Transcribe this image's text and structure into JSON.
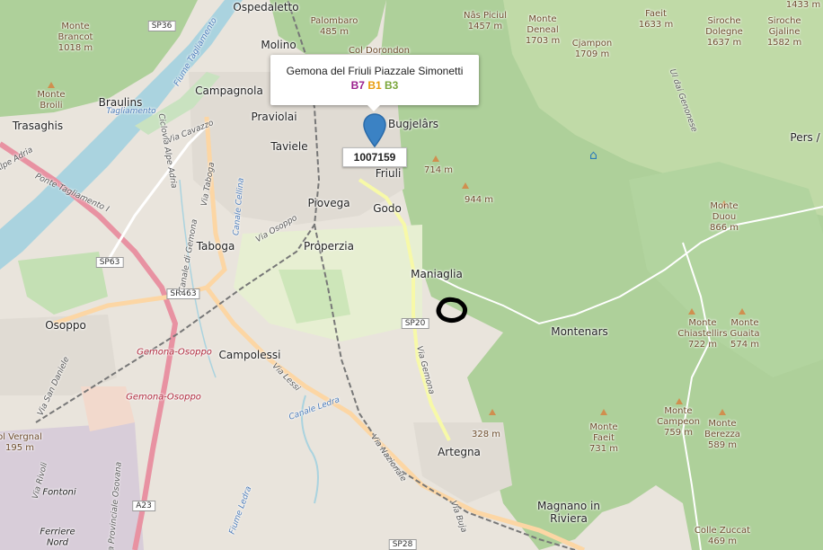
{
  "popup": {
    "title": "Gemona del Friuli Piazzale Simonetti",
    "codes": [
      {
        "text": "B7",
        "color": "#9b1f8e"
      },
      {
        "text": "B1",
        "color": "#e89b0c"
      },
      {
        "text": "B3",
        "color": "#7aa63a"
      }
    ]
  },
  "marker": {
    "label": "1007159",
    "color": "#3b82c4"
  },
  "towns": {
    "ospedaletto": "Ospedaletto",
    "molino": "Molino",
    "campagnola": "Campagnola",
    "praviolai": "Praviolai",
    "taviele": "Taviele",
    "braulins": "Braulins",
    "trasaghis": "Trasaghis",
    "piovega": "Piovega",
    "godo": "Godo",
    "friuli": "Friuli",
    "bugjelars": "Bugjelârs",
    "taboga": "Taboga",
    "properzia": "Properzia",
    "maniaglia": "Maniaglia",
    "osoppo": "Osoppo",
    "campolessi": "Campolessi",
    "montenars": "Montenars",
    "artegna": "Artegna",
    "magnano_1": "Magnano in",
    "magnano_2": "Riviera",
    "fontoni": "Fontoni",
    "ferriere_1": "Ferriere",
    "ferriere_2": "Nord",
    "pers": "Pers /"
  },
  "peaks": {
    "brancot": "Monte\nBrancot\n1018 m",
    "broili": "Monte\nBroili",
    "palombaro": "Palombaro\n485 m",
    "col_dorondon": "Col Dorondon",
    "nas_piciul": "Nâs Piciul\n1457 m",
    "deneal": "Monte\nDeneal\n1703 m",
    "cjampon": "Cjampon\n1709 m",
    "faeit_top": "Faeit\n1633 m",
    "sirioche": "Siroche\nDolegne\n1637 m",
    "sirioche_gjaline": "Siroche\nGjaline\n1582 m",
    "m1433": "1433 m",
    "m714": "714 m",
    "m944": "944 m",
    "duou": "Monte\nDuou\n866 m",
    "chiastellirs": "Monte\nChiastellirs\n722 m",
    "guaita": "Monte\nGuaita\n574 m",
    "campeon": "Monte\nCampeon\n759 m",
    "faeit_low": "Monte\nFaeit\n731 m",
    "berezza": "Monte\nBerezza\n589 m",
    "m328": "328 m",
    "vergnal": "ol Vergnal\n195 m",
    "colle_zuccat": "Colle Zuccat\n469 m"
  },
  "roads": {
    "sp36": "SP36",
    "sp63": "SP63",
    "sr463": "SR463",
    "sp20": "SP20",
    "a23": "A23",
    "sp28": "SP28",
    "via_cavazzo": "Via Cavazzo",
    "via_taboga": "Via Taboga",
    "via_osoppo": "Via Osoppo",
    "via_gemona": "Via Gemona",
    "via_lessi": "Via Lessi",
    "via_nazionale": "Via Nazionale",
    "via_buja": "Via Buja",
    "via_rivoli": "Via Rivoli",
    "via_san_daniele": "Via San Daniele",
    "via_prov_osovana": "Via Provinciale Osovana",
    "ponte": "Ponte Tagliamento I",
    "alpe_adria": "Alpe Adria",
    "ciclovia": "Ciclovia Alpe Adria",
    "canale_gemona": "Canale di Gemona",
    "ul_genonese": "Ul dai Genonese"
  },
  "waters": {
    "fiume_tagliamento": "Fiume Tagliamento",
    "canale_ledra": "Canale Ledra",
    "fiume_ledra": "Fiume Ledra",
    "tagliamento": "Tagliamento",
    "canale_cellin": "Canale Cellina"
  },
  "rail": {
    "gemona_osoppo_1": "Gemona-Osoppo",
    "gemona_osoppo_2": "Gemona-Osoppo"
  }
}
